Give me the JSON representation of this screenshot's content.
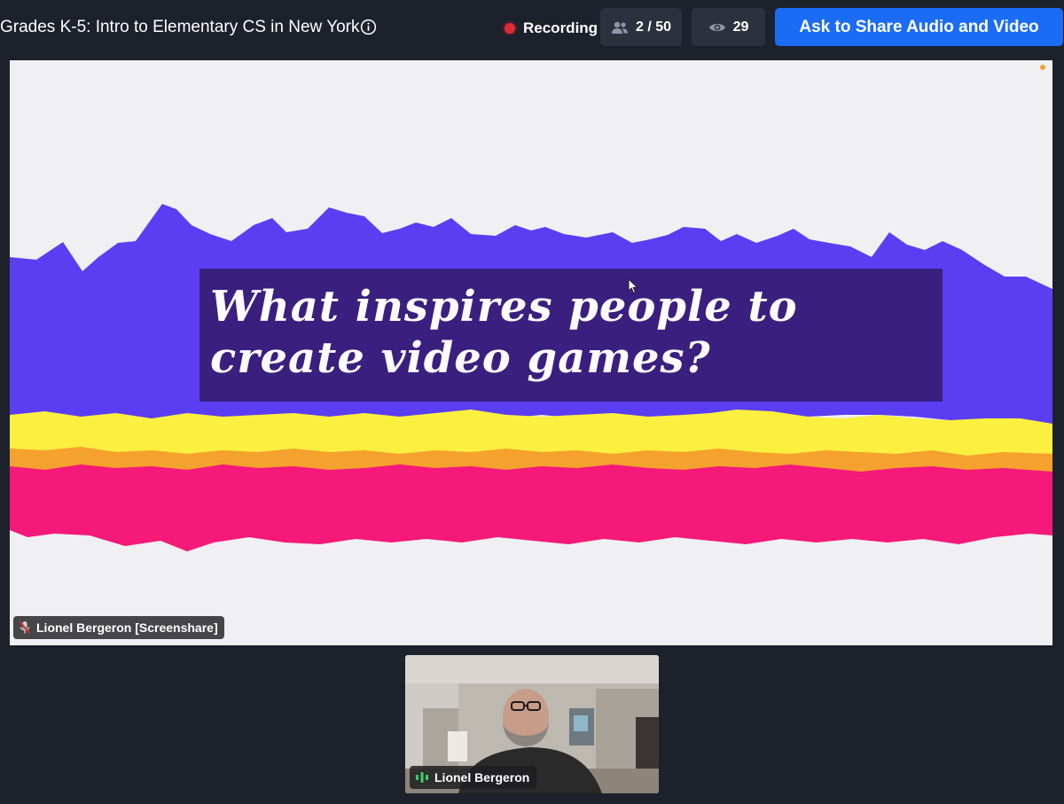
{
  "header": {
    "meeting_title": "Grades K-5: Intro to Elementary CS in New York",
    "recording_label": "Recording",
    "participants_count": "2 / 50",
    "viewers_count": "29",
    "ask_button_label": "Ask to Share Audio and Video"
  },
  "screenshare": {
    "slide_question": "What inspires people to create video games?",
    "presenter_label": "Lionel Bergeron [Screenshare]"
  },
  "camera": {
    "participant_name": "Lionel Bergeron"
  },
  "icons": {
    "info": "info-circle-icon",
    "participants": "people-icon",
    "viewers": "eye-icon",
    "muted": "microphone-muted-icon",
    "speaking": "audio-level-icon"
  },
  "colors": {
    "background": "#1c212c",
    "button": "#1b6cf5",
    "recording": "#e02a36",
    "slide_purple": "#5b3ef2",
    "slide_yellow": "#fbef3f",
    "slide_orange": "#f5a12e",
    "slide_pink": "#f5197a"
  }
}
